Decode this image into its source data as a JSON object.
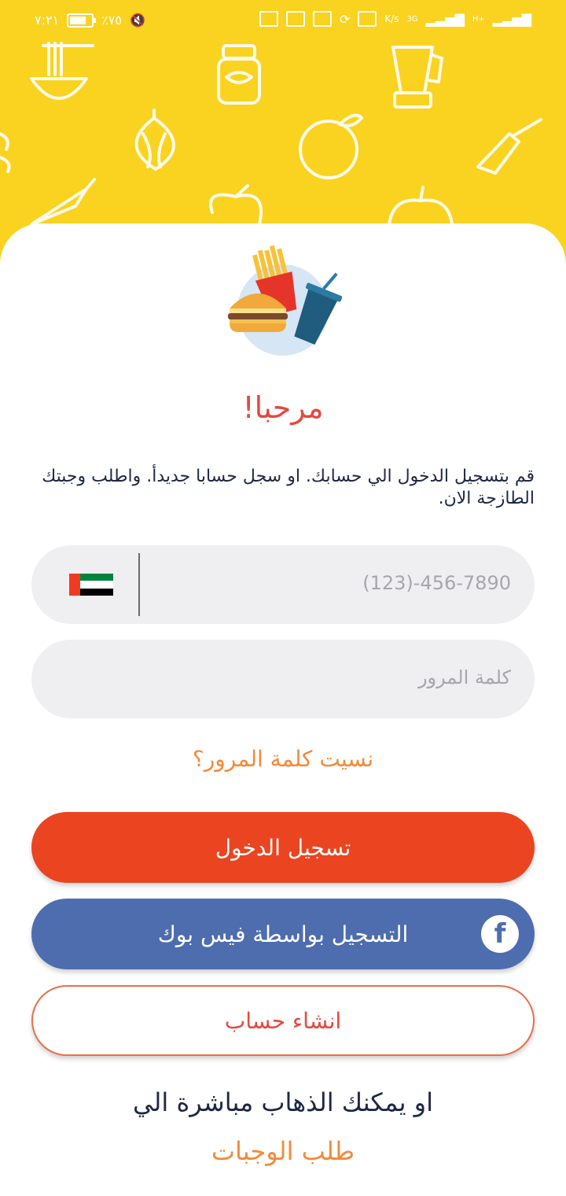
{
  "status_bar": {
    "time": "٧:٢١",
    "battery": "٪٧٥",
    "network_speed": "K/s",
    "net_3g": "3G",
    "net_h": "H+"
  },
  "welcome": {
    "title": "مرحبا!",
    "subtitle": "قم بتسجيل الدخول الي حسابك. او سجل حسابا جديدأ. واطلب وجبتك الطازجة الان."
  },
  "form": {
    "phone_placeholder": "(123)-456-7890",
    "password_placeholder": "كلمة المرور",
    "country_flag": "uae-flag"
  },
  "links": {
    "forgot_password": "نسيت كلمة المرور؟"
  },
  "buttons": {
    "login": "تسجيل الدخول",
    "facebook": "التسجيل بواسطة فيس بوك",
    "create_account": "انشاء حساب"
  },
  "footer": {
    "or_text": "او يمكنك الذهاب مباشرة الي",
    "meals_link": "طلب الوجبات"
  },
  "colors": {
    "header_yellow": "#F9D31F",
    "login_orange": "#EA4420",
    "facebook_blue": "#4E6DAF",
    "accent_red": "#E5483F",
    "link_orange": "#F28A3A",
    "text_navy": "#1E2747"
  }
}
